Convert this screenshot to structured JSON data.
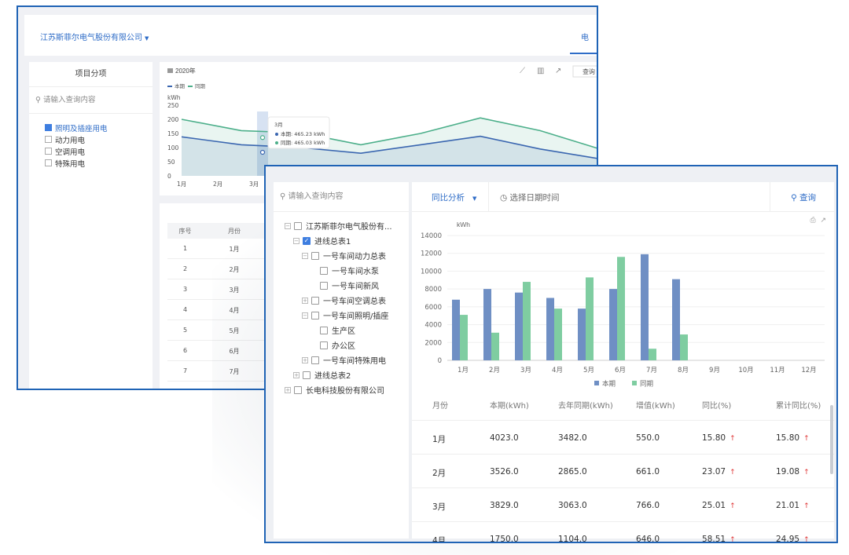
{
  "back": {
    "company": "江苏斯菲尔电气股份有限公司",
    "right_tab": "电",
    "left_title": "项目分项",
    "search_placeholder": "请输入查询内容",
    "tree": [
      {
        "label": "照明及插座用电",
        "checked": true
      },
      {
        "label": "动力用电",
        "checked": false
      },
      {
        "label": "空调用电",
        "checked": false
      },
      {
        "label": "特殊用电",
        "checked": false
      }
    ],
    "chart": {
      "year_label": "2020年",
      "query_label": "查询",
      "legend": [
        "本期",
        "同期"
      ],
      "unit": "kWh",
      "yticks": [
        "250",
        "200",
        "150",
        "100",
        "50",
        "0"
      ],
      "xticks": [
        "1月",
        "2月",
        "3月"
      ],
      "tooltip": {
        "title": "3月",
        "line1": "本期: 465.23 kWh",
        "line2": "同期: 465.03 kWh"
      }
    },
    "table": {
      "headers": [
        "序号",
        "月份"
      ],
      "rows": [
        [
          "1",
          "1月"
        ],
        [
          "2",
          "2月"
        ],
        [
          "3",
          "3月"
        ],
        [
          "4",
          "4月"
        ],
        [
          "5",
          "5月"
        ],
        [
          "6",
          "6月"
        ],
        [
          "7",
          "7月"
        ]
      ]
    }
  },
  "front": {
    "search_placeholder": "请输入查询内容",
    "tree": [
      {
        "label": "江苏斯菲尔电气股份有...",
        "level": 0,
        "checked": false,
        "exp": "−"
      },
      {
        "label": "进线总表1",
        "level": 1,
        "checked": true,
        "exp": "−"
      },
      {
        "label": "一号车间动力总表",
        "level": 2,
        "checked": false,
        "exp": "−"
      },
      {
        "label": "一号车间水泵",
        "level": 3,
        "checked": false,
        "exp": ""
      },
      {
        "label": "一号车间新风",
        "level": 3,
        "checked": false,
        "exp": ""
      },
      {
        "label": "一号车间空调总表",
        "level": 2,
        "checked": false,
        "exp": "+"
      },
      {
        "label": "一号车间照明/插座",
        "level": 2,
        "checked": false,
        "exp": "−"
      },
      {
        "label": "生产区",
        "level": 3,
        "checked": false,
        "exp": ""
      },
      {
        "label": "办公区",
        "level": 3,
        "checked": false,
        "exp": ""
      },
      {
        "label": "一号车间特殊用电",
        "level": 2,
        "checked": false,
        "exp": "+"
      },
      {
        "label": "进线总表2",
        "level": 1,
        "checked": false,
        "exp": "+"
      },
      {
        "label": "长电科技股份有限公司",
        "level": 0,
        "checked": false,
        "exp": "+"
      }
    ],
    "toolbar": {
      "mode": "同比分析",
      "date_placeholder": "选择日期时间",
      "query": "查询"
    },
    "table": {
      "headers": [
        "月份",
        "本期(kWh)",
        "去年同期(kWh)",
        "增值(kWh)",
        "同比(%)",
        "累计同比(%)"
      ],
      "rows": [
        [
          "1月",
          "4023.0",
          "3482.0",
          "550.0",
          "15.80",
          "15.80"
        ],
        [
          "2月",
          "3526.0",
          "2865.0",
          "661.0",
          "23.07",
          "19.08"
        ],
        [
          "3月",
          "3829.0",
          "3063.0",
          "766.0",
          "25.01",
          "21.01"
        ],
        [
          "4月",
          "1750.0",
          "1104.0",
          "646.0",
          "58.51",
          "24.95"
        ]
      ]
    }
  },
  "chart_data": [
    {
      "type": "bar",
      "title": "",
      "ylabel": "kWh",
      "categories": [
        "1月",
        "2月",
        "3月",
        "4月",
        "5月",
        "6月",
        "7月",
        "8月",
        "9月",
        "10月",
        "11月",
        "12月"
      ],
      "series": [
        {
          "name": "本期",
          "color": "#6f8fc4",
          "values": [
            6800,
            8000,
            7600,
            7000,
            5800,
            8000,
            11900,
            9100,
            null,
            null,
            null,
            null
          ]
        },
        {
          "name": "同期",
          "color": "#7fcda1",
          "values": [
            5100,
            3100,
            8800,
            5800,
            9300,
            11600,
            1300,
            2900,
            null,
            null,
            null,
            null
          ]
        }
      ],
      "ylim": [
        0,
        14000
      ],
      "yticks": [
        0,
        2000,
        4000,
        6000,
        8000,
        10000,
        12000,
        14000
      ],
      "grid": true,
      "legend": "bottom"
    },
    {
      "type": "line",
      "ylabel": "kWh",
      "categories": [
        "1月",
        "2月",
        "3月",
        "4月",
        "5月",
        "6月",
        "7月",
        "8月",
        "9月",
        "10月",
        "11月",
        "12月"
      ],
      "series": [
        {
          "name": "本期",
          "color": "#3a66b0",
          "values": [
            138,
            110,
            100,
            80,
            110,
            140,
            95,
            60
          ]
        },
        {
          "name": "同期",
          "color": "#4caf8a",
          "values": [
            200,
            160,
            152,
            110,
            150,
            205,
            160,
            95
          ]
        }
      ],
      "ylim": [
        0,
        250
      ],
      "legend": "top-left"
    }
  ]
}
